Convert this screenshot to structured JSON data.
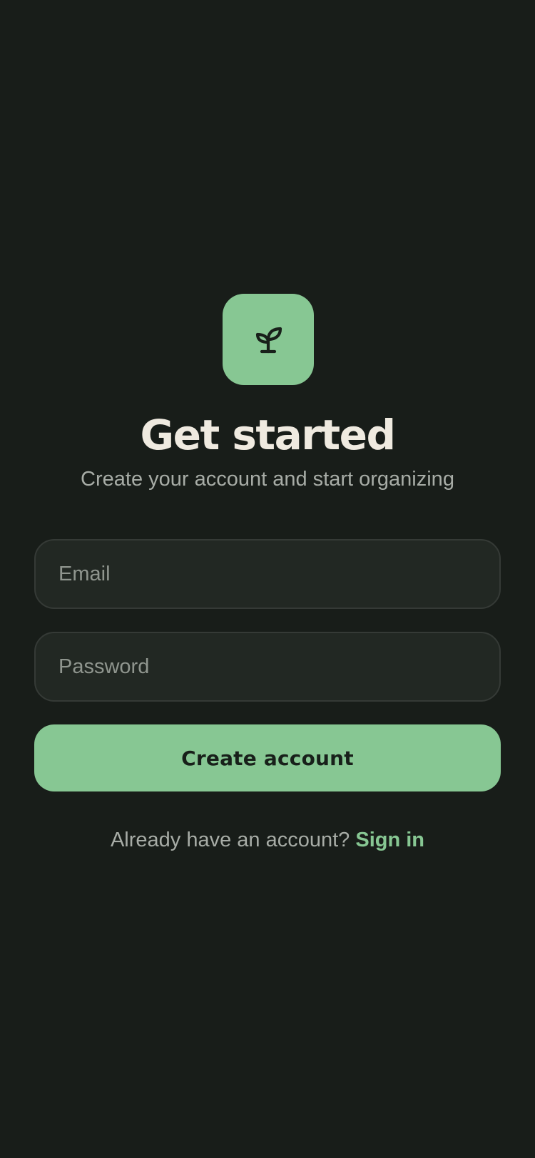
{
  "logo": {
    "icon": "sprout-icon",
    "tile_color": "#87c793"
  },
  "header": {
    "title": "Get started",
    "subtitle": "Create your account and start organizing"
  },
  "form": {
    "email": {
      "value": "",
      "placeholder": "Email"
    },
    "password": {
      "value": "",
      "placeholder": "Password"
    },
    "submit_label": "Create account"
  },
  "footer": {
    "prompt": "Already have an account?",
    "link_label": "Sign in"
  },
  "colors": {
    "background": "#181d19",
    "accent": "#87c793",
    "title_text": "#efeae0",
    "muted_text": "#a7aca6",
    "field_background": "#222823",
    "field_border": "#353a36"
  }
}
